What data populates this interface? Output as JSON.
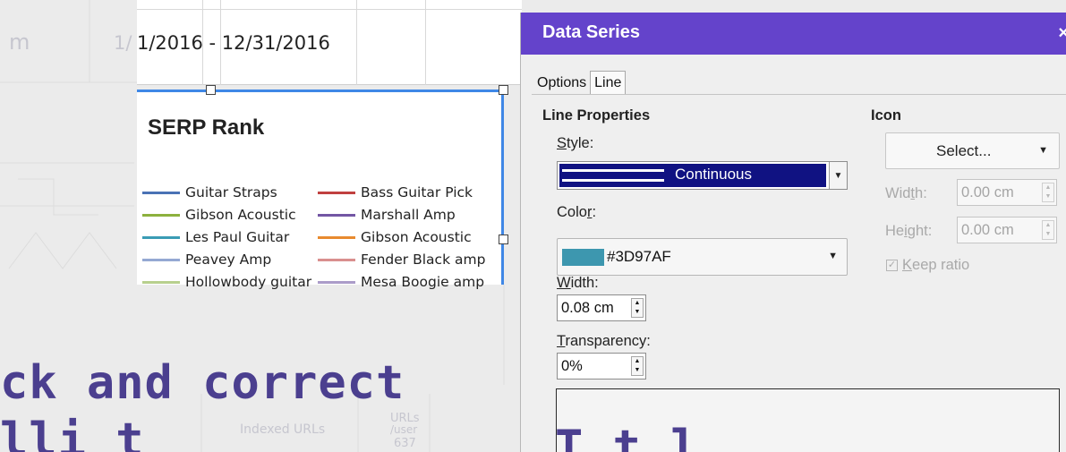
{
  "background": {
    "left_text": "m",
    "left_date_fragment": "1/",
    "headline_line1": "ck and correct",
    "headline_line2": "lli t",
    "headline_right": "T t l",
    "table_label": "Indexed URLs",
    "table_label2": "URLs",
    "table_sub": "/user",
    "table_value": "637"
  },
  "sheet": {
    "date_range": "1/2016 - 12/31/2016"
  },
  "chart": {
    "title": "SERP Rank",
    "legend": [
      {
        "label": "Guitar Straps",
        "color": "#4a72b5"
      },
      {
        "label": "Bass Guitar Pick",
        "color": "#c0403f"
      },
      {
        "label": "Gibson Acoustic",
        "color": "#8db13e"
      },
      {
        "label": "Marshall Amp",
        "color": "#7356a4"
      },
      {
        "label": "Les Paul Guitar",
        "color": "#3a9cb5"
      },
      {
        "label": "Gibson Acoustic",
        "color": "#e88a2f"
      },
      {
        "label": "Peavey Amp",
        "color": "#95a9d3"
      },
      {
        "label": "Fender Black amp",
        "color": "#d98f8e"
      },
      {
        "label": "Hollowbody guitar",
        "color": "#b8d08e"
      },
      {
        "label": "Mesa Boogie amp",
        "color": "#ab9cc9"
      }
    ]
  },
  "dialog": {
    "title": "Data Series",
    "close_glyph": "×",
    "tabs": [
      {
        "label": "Options",
        "active": false
      },
      {
        "label": "Line",
        "active": true
      }
    ],
    "line_properties": {
      "heading": "Line Properties",
      "style_label_u": "S",
      "style_label_rest": "tyle:",
      "style_value": "Continuous",
      "color_label_pre": "Colo",
      "color_label_u": "r",
      "color_label_post": ":",
      "color_value": "#3D97AF",
      "color_swatch": "#3D97AF",
      "width_label_u": "W",
      "width_label_rest": "idth:",
      "width_value": "0.08 cm",
      "transparency_label_u": "T",
      "transparency_label_rest": "ransparency:",
      "transparency_value": "0%"
    },
    "icon": {
      "heading": "Icon",
      "select_label": "Select...",
      "width_label_pre": "Wid",
      "width_label_u": "t",
      "width_label_post": "h:",
      "width_value": "0.00 cm",
      "height_label_pre": "He",
      "height_label_u": "i",
      "height_label_post": "ght:",
      "height_value": "0.00 cm",
      "keep_ratio_u": "K",
      "keep_ratio_rest": "eep ratio",
      "keep_ratio_checked": true
    }
  },
  "colors": {
    "titlebar": "#6443cb",
    "selection": "#101282",
    "chart_border": "#3f87e6"
  }
}
